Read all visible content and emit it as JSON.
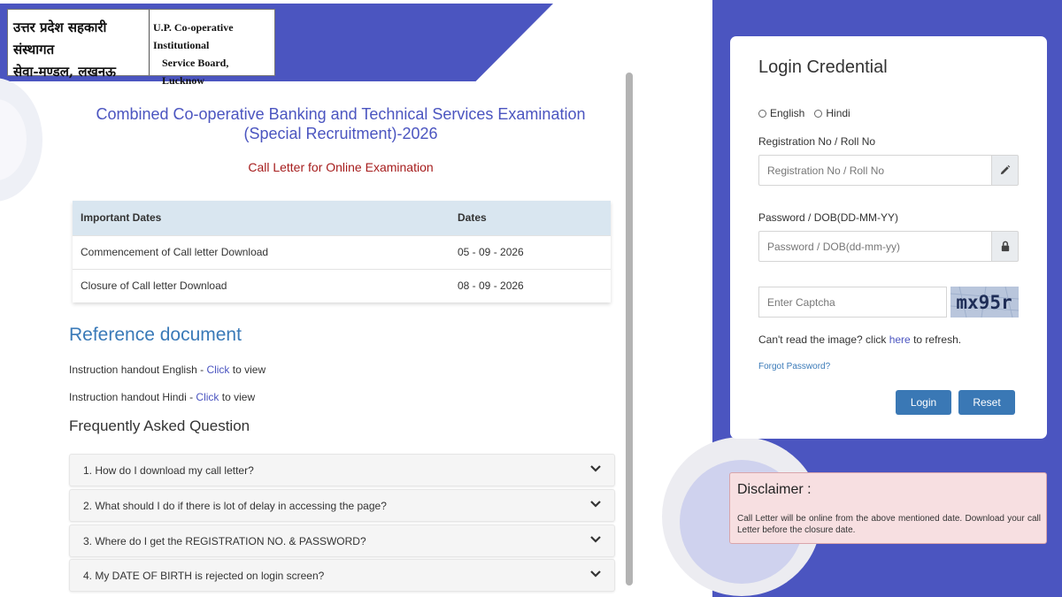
{
  "header": {
    "logo_hindi_line1": "उत्तर प्रदेश सहकारी संस्थागत",
    "logo_hindi_line2": "सेवा-मण्डल, लखनऊ",
    "logo_en_line1": "U.P. Co-operative Institutional",
    "logo_en_line2": "Service Board, Lucknow"
  },
  "main": {
    "exam_title": "Combined Co-operative Banking and Technical Services Examination (Special Recruitment)-2026",
    "call_letter": "Call Letter for Online Examination",
    "dates_table": {
      "headers": [
        "Important Dates",
        "Dates"
      ],
      "rows": [
        [
          "Commencement of Call letter Download",
          "05 - 09 - 2026"
        ],
        [
          "Closure of Call letter Download",
          "08 - 09 - 2026"
        ]
      ]
    },
    "reference": {
      "heading": "Reference document",
      "english_prefix": "Instruction handout English - ",
      "hindi_prefix": "Instruction handout Hindi - ",
      "click": "Click",
      "to_view": " to view"
    },
    "faq": {
      "heading": "Frequently Asked Question",
      "items": [
        "1. How do I download my call letter?",
        "2. What should I do if there is lot of delay in accessing the page?",
        "3. Where do I get the REGISTRATION NO. & PASSWORD?",
        "4. My DATE OF BIRTH is rejected on login screen?"
      ]
    }
  },
  "login": {
    "title": "Login Credential",
    "lang_english": "English",
    "lang_hindi": "Hindi",
    "reg_label": "Registration No / Roll No",
    "reg_placeholder": "Registration No / Roll No",
    "pwd_label": "Password / DOB(DD-MM-YY)",
    "pwd_placeholder": "Password / DOB(dd-mm-yy)",
    "captcha_placeholder": "Enter Captcha",
    "captcha_text": "mx95r",
    "cant_read_prefix": "Can't read the image? click ",
    "cant_read_link": "here",
    "cant_read_suffix": " to refresh.",
    "forgot": "Forgot Password?",
    "login_btn": "Login",
    "reset_btn": "Reset"
  },
  "disclaimer": {
    "title": "Disclaimer :",
    "text": "Call Letter will be online from the above mentioned date. Download your call Letter before the closure date."
  },
  "colors": {
    "brand_blue": "#4b55c0",
    "accent_red": "#a61d1d",
    "button_blue": "#3a78b5",
    "disclaimer_bg": "#f7dfe1"
  },
  "icons": [
    "pencil-icon",
    "lock-icon",
    "chevron-down-icon"
  ]
}
